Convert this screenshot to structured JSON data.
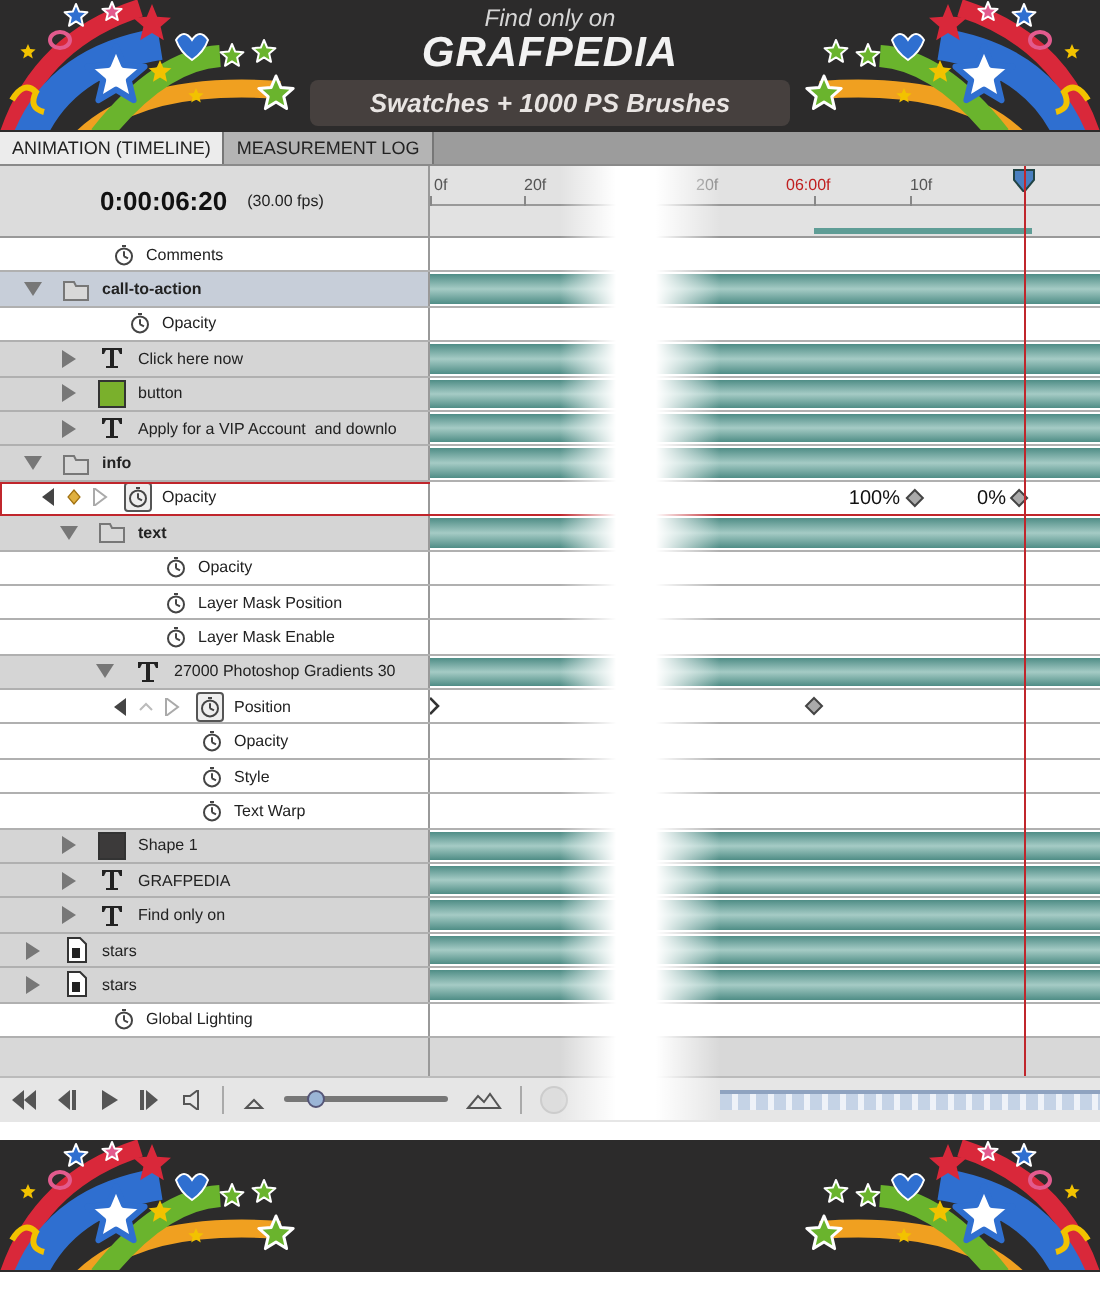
{
  "banner_top": {
    "tagline": "Find only on",
    "title": "GRAFPEDIA",
    "subtitle": "Swatches + 1000 PS Brushes"
  },
  "tabs": [
    {
      "label": "ANIMATION (TIMELINE)",
      "selected": true
    },
    {
      "label": "MEASUREMENT LOG",
      "selected": false
    }
  ],
  "timeline": {
    "current_time": "0:00:06:20",
    "frame_rate": "(30.00 fps)",
    "ruler_labels": [
      {
        "label": "0f",
        "kind": "normal"
      },
      {
        "label": "20f",
        "kind": "normal"
      },
      {
        "label": "20f",
        "kind": "faded"
      },
      {
        "label": "06:00f",
        "kind": "current"
      },
      {
        "label": "10f",
        "kind": "normal"
      }
    ],
    "layers": [
      {
        "kind": "property",
        "label": "Comments",
        "selected": false
      },
      {
        "kind": "group",
        "label": "call-to-action",
        "expanded": true,
        "selected": true,
        "children": [
          {
            "kind": "property",
            "label": "Opacity",
            "selected": false
          },
          {
            "kind": "text",
            "label": "Click here now",
            "expanded": false,
            "selected": false
          },
          {
            "kind": "shape",
            "label": "button",
            "expanded": false,
            "selected": false,
            "color": "#7ab02c"
          },
          {
            "kind": "text",
            "label": "Apply for a VIP Account  and downlo",
            "expanded": false,
            "selected": false
          }
        ]
      },
      {
        "kind": "group",
        "label": "info",
        "expanded": true,
        "selected": false,
        "children": [
          {
            "kind": "keyed",
            "label": "Opacity",
            "selected": true,
            "key_at_current": true,
            "keyframes": [
              {
                "kind": "key",
                "value": "100%"
              },
              {
                "kind": "key",
                "value": "0%"
              }
            ]
          },
          {
            "kind": "group",
            "label": "text",
            "expanded": true,
            "selected": false,
            "children": [
              {
                "kind": "property",
                "label": "Opacity",
                "selected": false
              },
              {
                "kind": "property",
                "label": "Layer Mask Position",
                "selected": false
              },
              {
                "kind": "property",
                "label": "Layer Mask Enable",
                "selected": false
              },
              {
                "kind": "text",
                "label": "27000 Photoshop Gradients 30",
                "expanded": true,
                "selected": false,
                "children": [
                  {
                    "kind": "keyed",
                    "label": "Position",
                    "selected": false,
                    "key_at_current": false,
                    "keyframes": [
                      {
                        "kind": "edge"
                      },
                      {
                        "kind": "key"
                      }
                    ]
                  },
                  {
                    "kind": "property",
                    "label": "Opacity",
                    "selected": false
                  },
                  {
                    "kind": "property",
                    "label": "Style",
                    "selected": false
                  },
                  {
                    "kind": "property",
                    "label": "Text Warp",
                    "selected": false
                  }
                ]
              }
            ]
          },
          {
            "kind": "shape",
            "label": "Shape 1",
            "expanded": false,
            "selected": false,
            "color": "#3c3a3a"
          },
          {
            "kind": "text",
            "label": "GRAFPEDIA",
            "expanded": false,
            "selected": false
          },
          {
            "kind": "text",
            "label": "Find only on",
            "expanded": false,
            "selected": false
          }
        ]
      },
      {
        "kind": "smart",
        "label": "stars",
        "expanded": false,
        "selected": false
      },
      {
        "kind": "smart",
        "label": "stars",
        "expanded": false,
        "selected": false
      },
      {
        "kind": "property",
        "label": "Global Lighting",
        "selected": false
      }
    ]
  },
  "controls": {
    "zoom_slider": {
      "level": 0.2
    }
  }
}
